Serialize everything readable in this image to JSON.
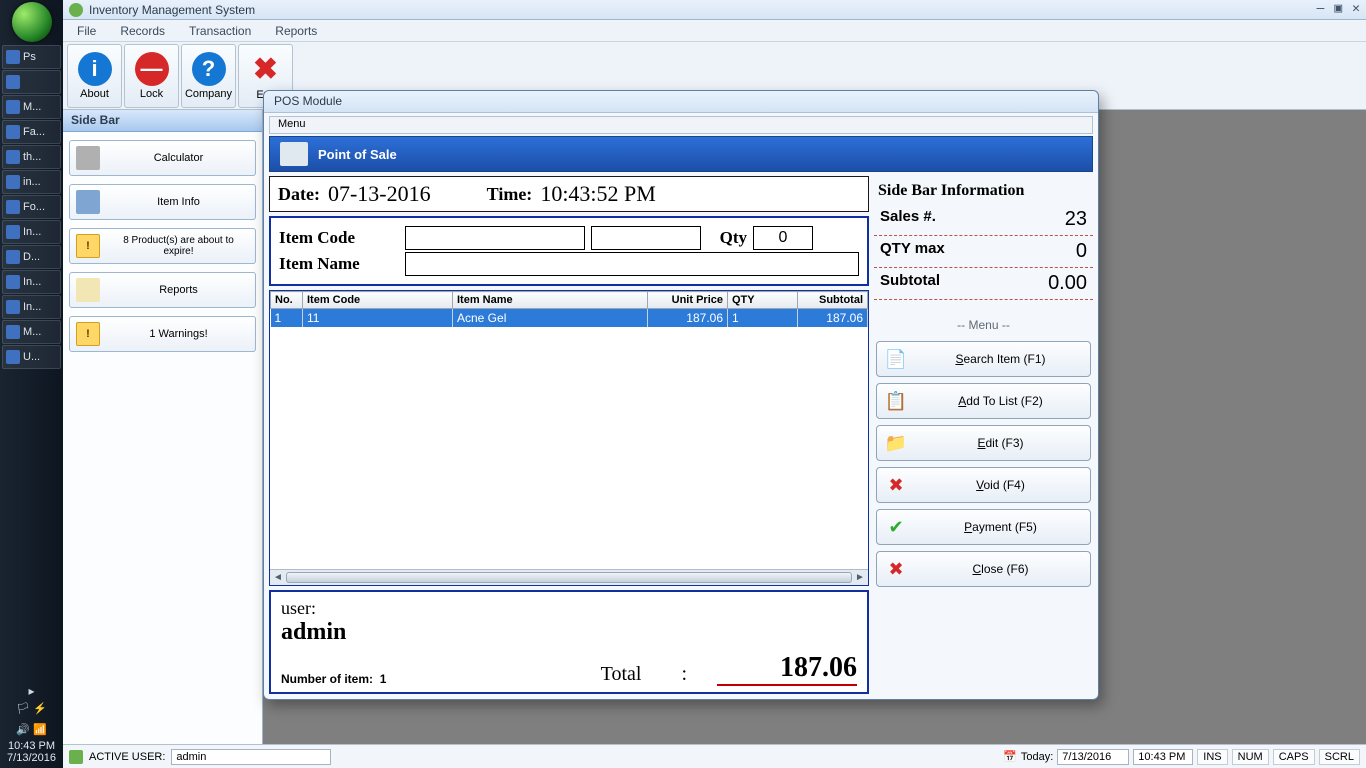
{
  "taskbar": {
    "items": [
      {
        "label": "Ps"
      },
      {
        "label": ""
      },
      {
        "label": "M..."
      },
      {
        "label": "Fa..."
      },
      {
        "label": "th..."
      },
      {
        "label": "in..."
      },
      {
        "label": "Fo..."
      },
      {
        "label": "In..."
      },
      {
        "label": "D..."
      },
      {
        "label": "In..."
      },
      {
        "label": "In..."
      },
      {
        "label": "M..."
      },
      {
        "label": "U..."
      }
    ],
    "time": "10:43 PM",
    "date": "7/13/2016"
  },
  "app": {
    "title": "Inventory Management System",
    "menu": [
      "File",
      "Records",
      "Transaction",
      "Reports"
    ],
    "toolbar": {
      "about": "About",
      "lock": "Lock",
      "company": "Company",
      "exit": "Exit"
    }
  },
  "sidebar": {
    "title": "Side Bar",
    "buttons": {
      "calculator": "Calculator",
      "iteminfo": "Item Info",
      "expire": "8 Product(s) are about to expire!",
      "reports": "Reports",
      "warnings": "1 Warnings!"
    }
  },
  "pos": {
    "title": "POS Module",
    "menu": "Menu",
    "banner": "Point of Sale",
    "date_label": "Date:",
    "date_value": "07-13-2016",
    "time_label": "Time:",
    "time_value": "10:43:52 PM",
    "item_code_label": "Item Code",
    "item_name_label": "Item Name",
    "qty_label": "Qty",
    "qty_value": "0",
    "grid_headers": [
      "No.",
      "Item Code",
      "Item Name",
      "Unit Price",
      "QTY",
      "Subtotal"
    ],
    "grid_rows": [
      {
        "no": "1",
        "code": "11",
        "name": "Acne Gel",
        "price": "187.06",
        "qty": "1",
        "subtotal": "187.06"
      }
    ],
    "user_label": "user:",
    "user_value": "admin",
    "numitems_label": "Number of item:",
    "numitems_value": "1",
    "total_label": "Total",
    "total_colon": ":",
    "total_value": "187.06",
    "sidebar_info_title": "Side Bar Information",
    "info": {
      "sales_label": "Sales #.",
      "sales_value": "23",
      "qtymax_label": "QTY max",
      "qtymax_value": "0",
      "subtotal_label": "Subtotal",
      "subtotal_value": "0.00"
    },
    "menu_sep": "-- Menu --",
    "actions": {
      "search": "Search Item (F1)",
      "add": "Add To List (F2)",
      "edit": "Edit (F3)",
      "void": "Void (F4)",
      "payment": "Payment (F5)",
      "close": "Close (F6)"
    }
  },
  "status": {
    "active_user_label": "ACTIVE USER:",
    "active_user_value": "admin",
    "today_label": "Today:",
    "today_date": "7/13/2016",
    "today_time": "10:43 PM",
    "indicators": [
      "INS",
      "NUM",
      "CAPS",
      "SCRL"
    ]
  }
}
